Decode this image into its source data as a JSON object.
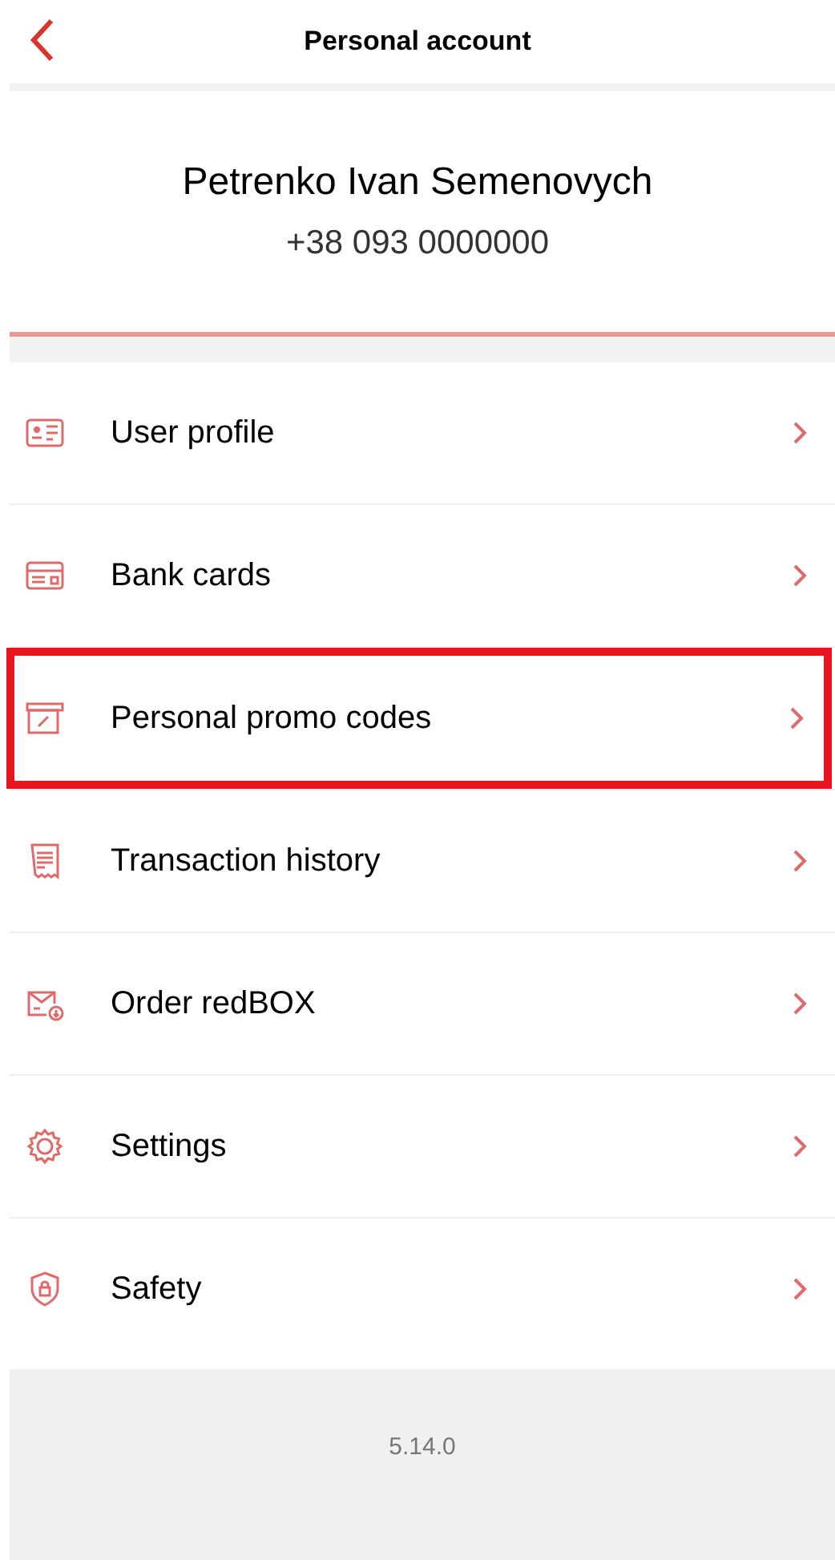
{
  "header": {
    "title": "Personal account"
  },
  "profile": {
    "name": "Petrenko Ivan Semenovych",
    "phone": "+38 093 0000000"
  },
  "menu": [
    {
      "kind": "profile",
      "label": "User profile",
      "highlighted": false
    },
    {
      "kind": "card",
      "label": "Bank cards",
      "highlighted": false
    },
    {
      "kind": "promo",
      "label": "Personal promo codes",
      "highlighted": true
    },
    {
      "kind": "receipt",
      "label": "Transaction history",
      "highlighted": false
    },
    {
      "kind": "box",
      "label": "Order redBOX",
      "highlighted": false
    },
    {
      "kind": "gear",
      "label": "Settings",
      "highlighted": false
    },
    {
      "kind": "shield",
      "label": "Safety",
      "highlighted": false
    }
  ],
  "footer": {
    "version": "5.14.0"
  }
}
